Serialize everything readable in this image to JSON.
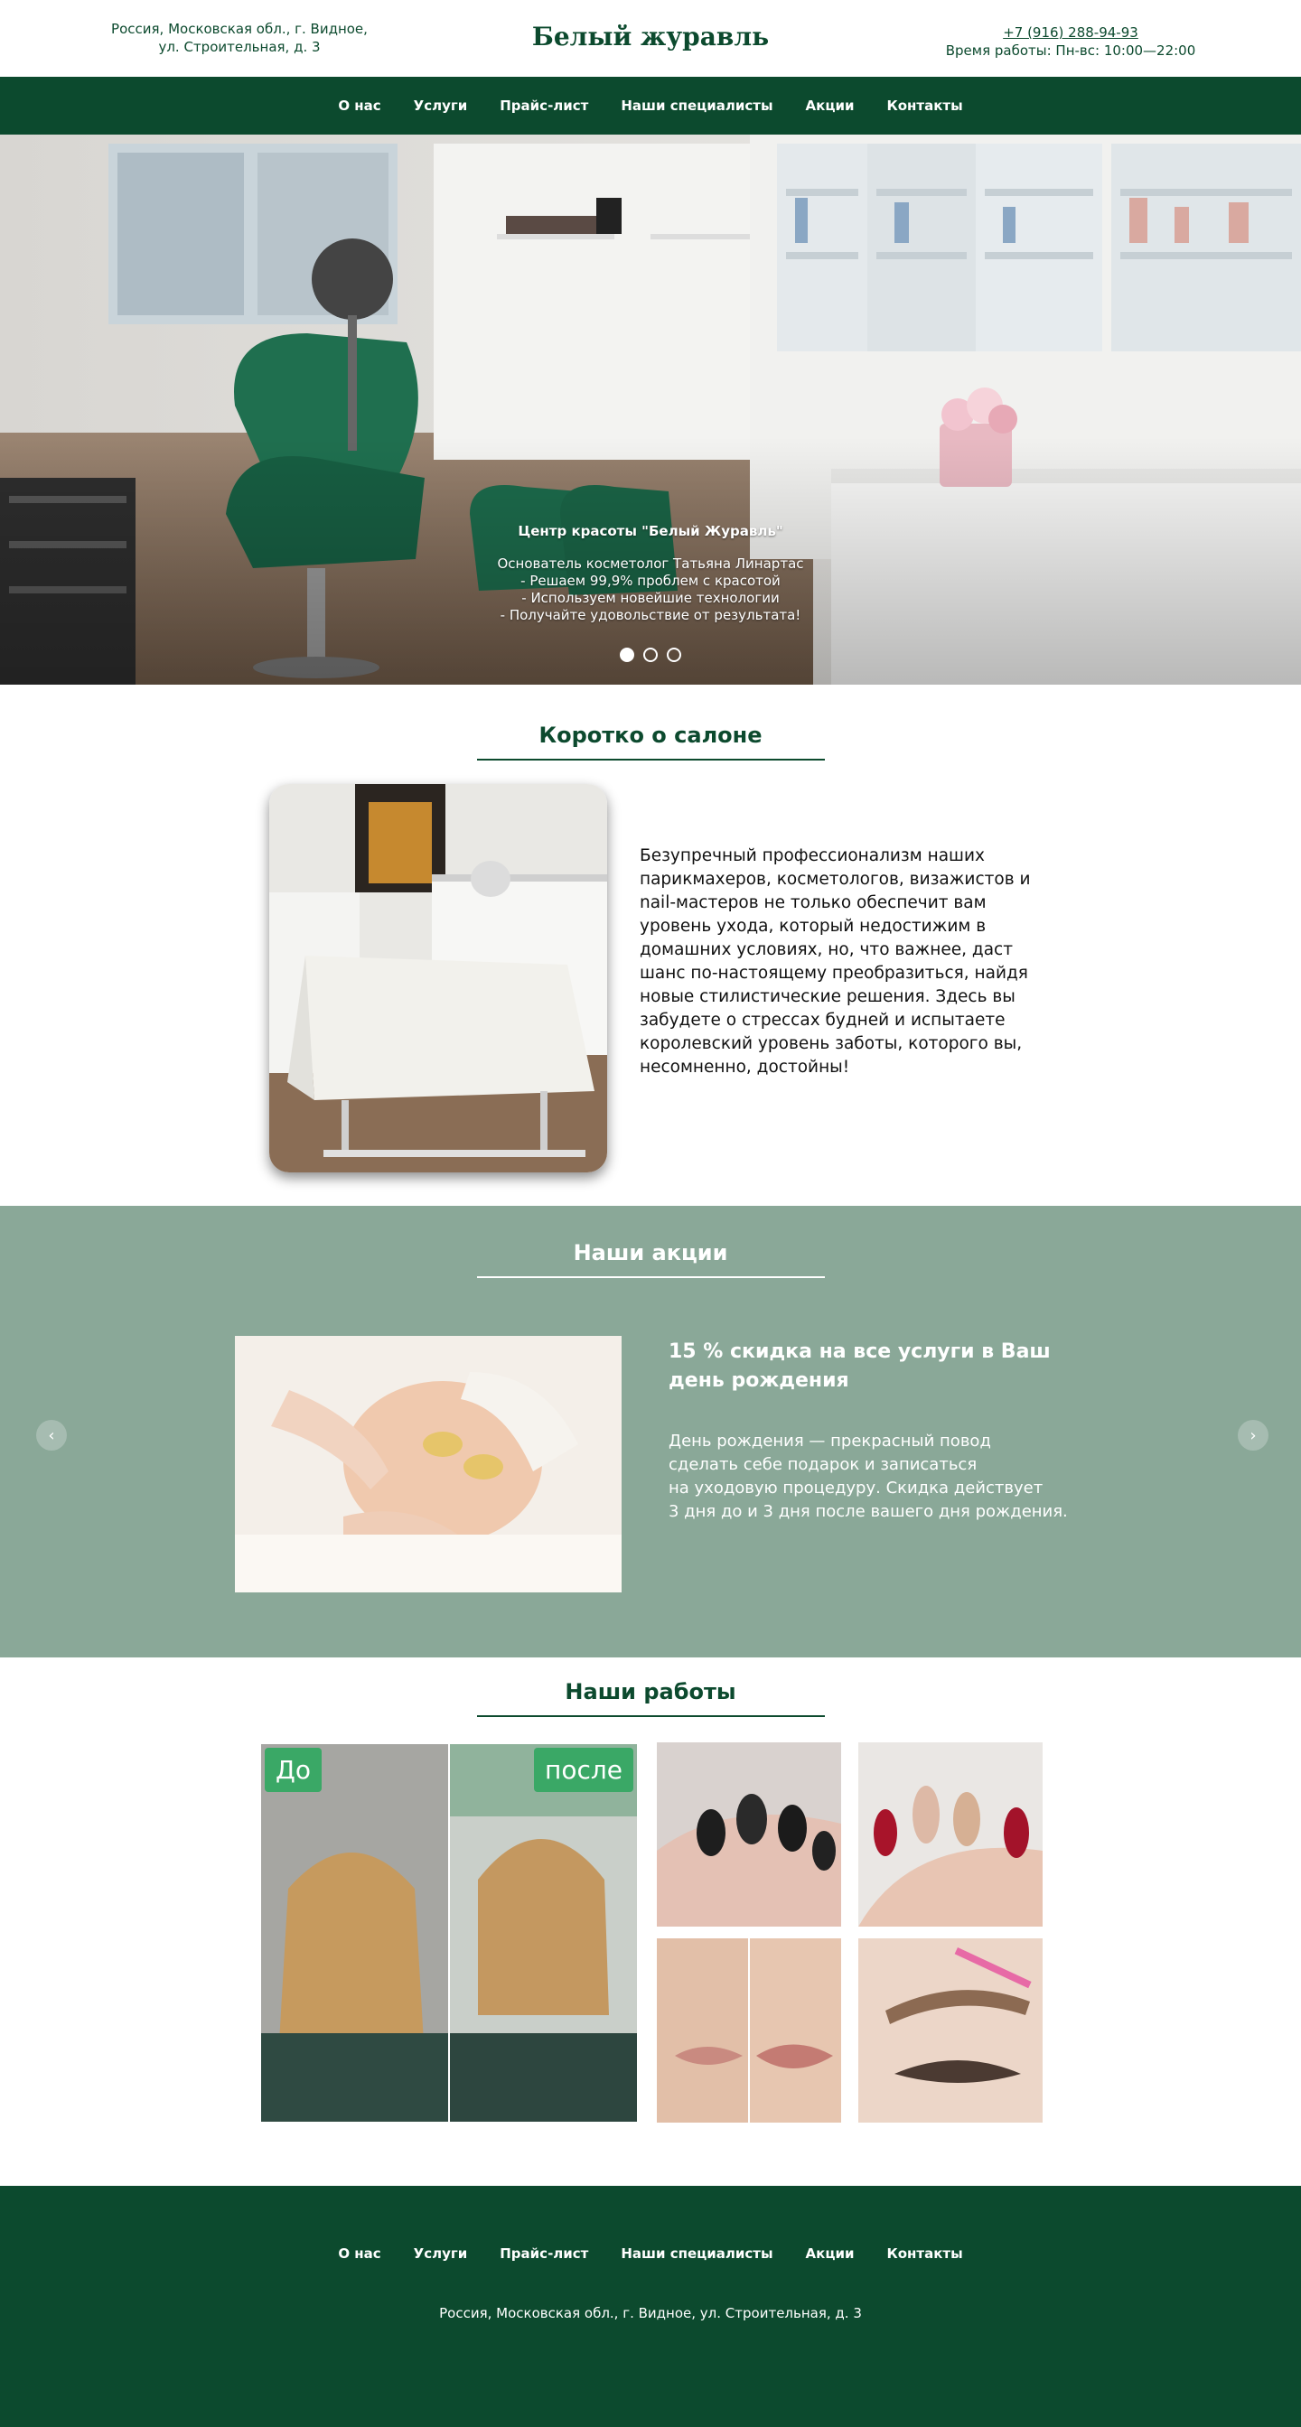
{
  "header": {
    "address_line1": "Россия, Московская обл., г. Видное,",
    "address_line2": "ул. Строительная, д. 3",
    "brand": "Белый журавль",
    "phone": "+7 (916) 288-94-93",
    "hours": "Время работы: Пн-вс: 10:00—22:00"
  },
  "nav": {
    "items": [
      "О нас",
      "Услуги",
      "Прайс-лист",
      "Наши специалисты",
      "Акции",
      "Контакты"
    ]
  },
  "hero": {
    "title": "Центр красоты \"Белый Журавль\"",
    "line1": "Основатель косметолог Татьяна Линартас",
    "line2": "- Решаем 99,9% проблем с красотой",
    "line3": "- Используем новейшие технологии",
    "line4": "- Получайте удовольствие от результата!",
    "slide_count": 3,
    "active_slide": 1
  },
  "about": {
    "title": "Коротко о салоне",
    "text": "Безупречный профессионализм наших парикмахеров, косметологов, визажистов и nail-мастеров не только обеспечит вам уровень ухода, который недостижим в домашних условиях, но, что важнее, даст шанс по-настоящему преобразиться, найдя новые стилистические решения. Здесь вы забудете о стрессах будней и испытаете королевский уровень заботы, которого вы, несомненно, достойны!"
  },
  "promo": {
    "title": "Наши акции",
    "heading": "15 % скидка на все услуги в Ваш день рождения",
    "text_line1": "День рождения — прекрасный повод",
    "text_line2": "сделать себе подарок и записаться",
    "text_line3": "на уходовую процедуру. Скидка действует",
    "text_line4": "3 дня до и 3 дня после вашего дня рождения.",
    "prev_icon": "chevron-left-icon",
    "next_icon": "chevron-right-icon"
  },
  "works": {
    "title": "Наши работы",
    "before_label": "До",
    "after_label": "после"
  },
  "footer": {
    "nav_items": [
      "О нас",
      "Услуги",
      "Прайс-лист",
      "Наши специалисты",
      "Акции",
      "Контакты"
    ],
    "address": "Россия, Московская обл., г. Видное, ул. Строительная, д. 3"
  },
  "colors": {
    "primary": "#0c4a2e",
    "promo_bg": "#8aa898",
    "badge": "#3aa866"
  }
}
